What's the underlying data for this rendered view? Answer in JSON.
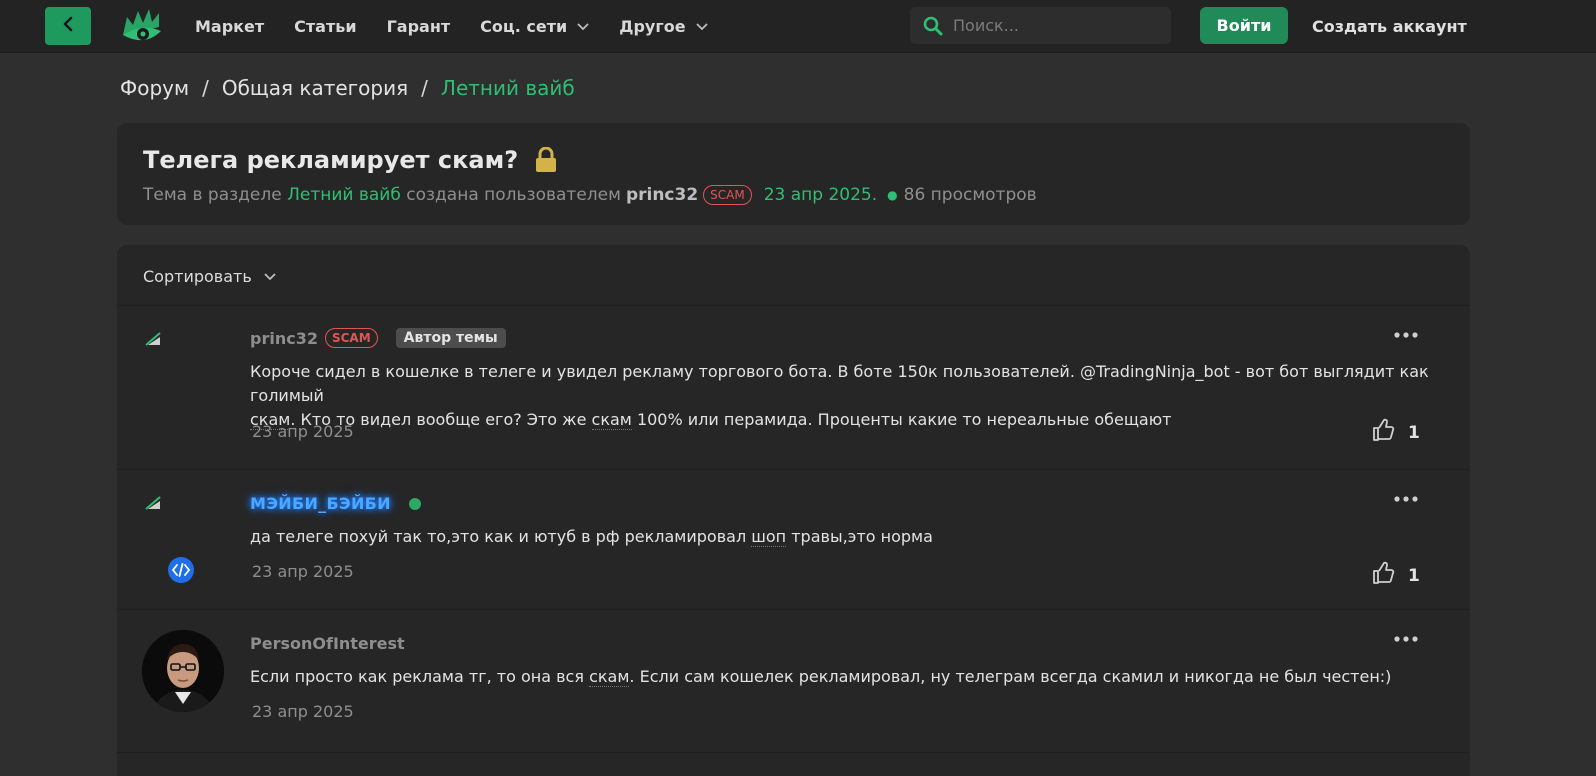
{
  "header": {
    "nav": [
      {
        "label": "Маркет"
      },
      {
        "label": "Статьи"
      },
      {
        "label": "Гарант"
      },
      {
        "label": "Соц. сети",
        "dropdown": true
      },
      {
        "label": "Другое",
        "dropdown": true
      }
    ],
    "search_placeholder": "Поиск...",
    "login_label": "Войти",
    "signup_label": "Создать аккаунт"
  },
  "breadcrumb": [
    "Форум",
    "Общая категория",
    "Летний вайб"
  ],
  "thread": {
    "title": "Телега рекламирует скам?",
    "meta_prefix": "Тема в разделе",
    "section": "Летний вайб",
    "meta_created_by": "создана пользователем",
    "author": "princ32",
    "author_badge": "SCAM",
    "date": "23 апр 2025.",
    "views": "86 просмотров"
  },
  "sort_label": "Сортировать",
  "posts": [
    {
      "author": "princ32",
      "badge": "SCAM",
      "role": "Автор темы",
      "body_1": "Короче сидел в кошелке в телеге и увидел рекламу торгового бота. В боте 150к пользователей. @TradingNinja_bot - вот бот выглядит как голимый",
      "body_2a": "скам",
      "body_2b": ". Кто то видел вообще его? Это же ",
      "body_2c": "скам",
      "body_2d": " 100% или перамида. Проценты какие то нереальные обещают",
      "date": "23 апр 2025",
      "likes": "1"
    },
    {
      "author": "МЭЙБИ_БЭЙБИ",
      "online": true,
      "body_a": "да телеге похуй так то,это как и ютуб в рф рекламировал ",
      "body_b": "шоп",
      "body_c": " травы,это норма",
      "date": "23 апр 2025",
      "likes": "1"
    },
    {
      "author": "PersonOfInterest",
      "body_a": "Если просто как реклама тг, то она вся ",
      "body_b": "скам",
      "body_c": ". Если сам кошелек рекламировал, ну телеграм всегда скамил и никогда не был честен:)",
      "date": "23 апр 2025"
    }
  ],
  "colors": {
    "accent": "#2fbf74",
    "button": "#218a59",
    "scam": "#e25555",
    "lock": "#d4b24a"
  }
}
